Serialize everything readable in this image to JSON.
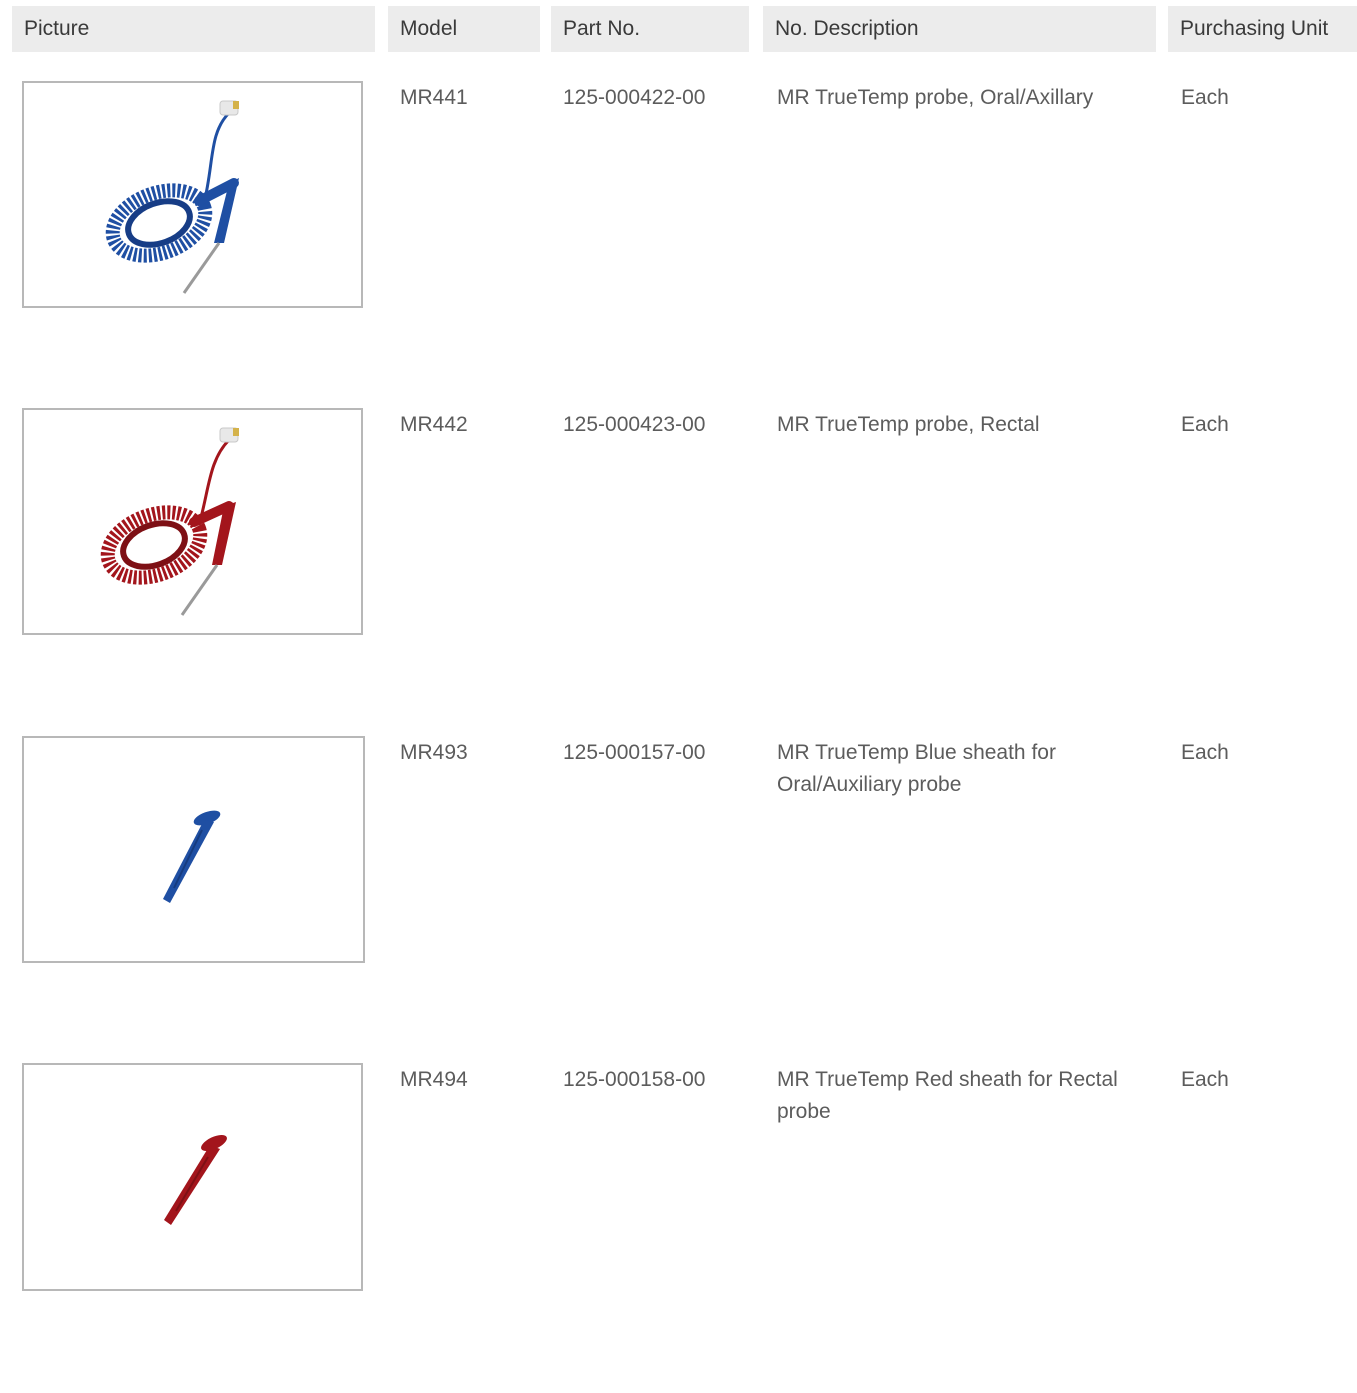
{
  "header": {
    "picture": "Picture",
    "model": "Model",
    "part_no": "Part No.",
    "description": "No. Description",
    "unit": "Purchasing Unit"
  },
  "rows": [
    {
      "model": "MR441",
      "part_no": "125-000422-00",
      "description": "MR TrueTemp probe, Oral/Axillary",
      "unit": "Each",
      "image": "blue-probe-image",
      "color": "#1f4fa3"
    },
    {
      "model": "MR442",
      "part_no": "125-000423-00",
      "description": "MR TrueTemp probe, Rectal",
      "unit": "Each",
      "image": "red-probe-image",
      "color": "#a3151c"
    },
    {
      "model": "MR493",
      "part_no": "125-000157-00",
      "description": "MR TrueTemp Blue sheath for Oral/Auxiliary probe",
      "unit": "Each",
      "image": "blue-sheath-image",
      "color": "#1f4fa3"
    },
    {
      "model": "MR494",
      "part_no": "125-000158-00",
      "description": "MR TrueTemp Red sheath for Rectal probe",
      "unit": "Each",
      "image": "red-sheath-image",
      "color": "#a3151c"
    }
  ],
  "colors": {
    "header_bg": "#ececec",
    "border": "#b8b8b8",
    "text": "#5c5c5c"
  }
}
